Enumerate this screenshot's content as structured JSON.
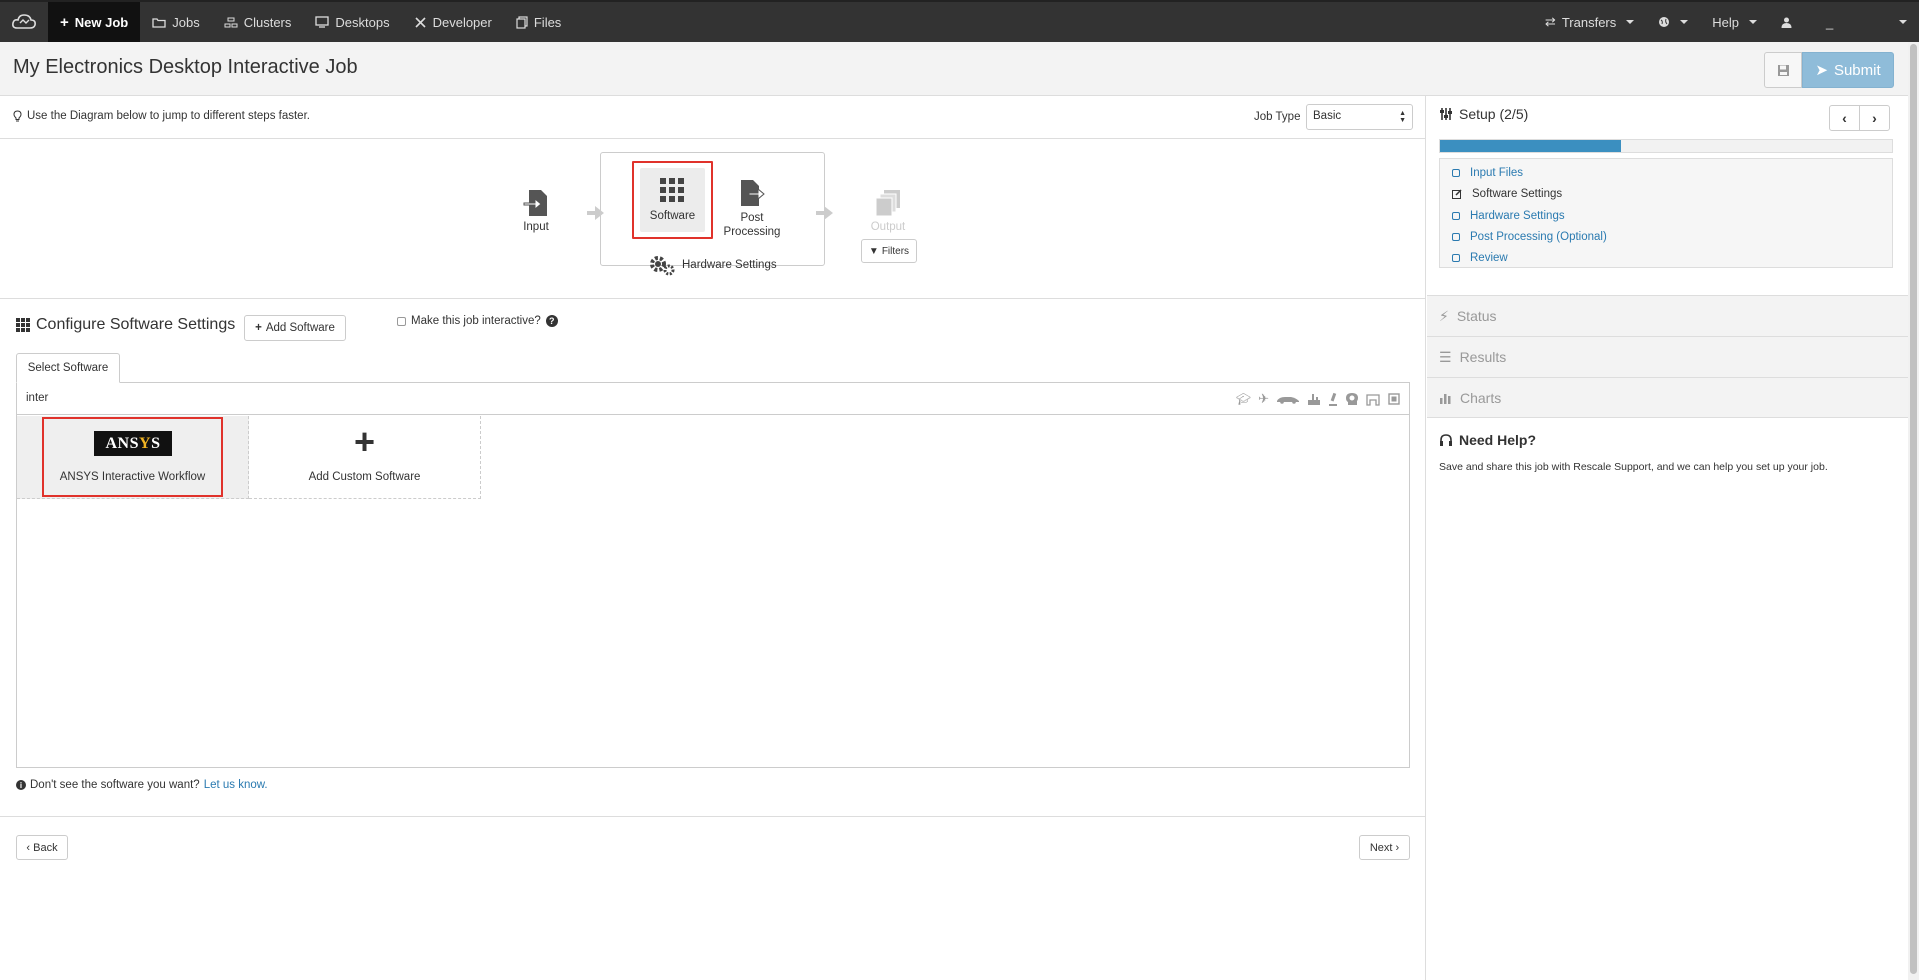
{
  "nav": {
    "items": [
      {
        "label": "New Job",
        "icon": "plus-icon",
        "active": true
      },
      {
        "label": "Jobs",
        "icon": "folder-icon"
      },
      {
        "label": "Clusters",
        "icon": "clusters-icon"
      },
      {
        "label": "Desktops",
        "icon": "monitor-icon"
      },
      {
        "label": "Developer",
        "icon": "tools-icon"
      },
      {
        "label": "Files",
        "icon": "files-icon"
      }
    ],
    "right": {
      "transfers": "Transfers",
      "help": "Help",
      "user": "_"
    }
  },
  "title": "My Electronics Desktop Interactive Job",
  "submit_label": "Submit",
  "hint": "Use the Diagram below to jump to different steps faster.",
  "job_type": {
    "label": "Job Type",
    "value": "Basic"
  },
  "diagram": {
    "input": "Input",
    "software": "Software",
    "post_processing": "Post Processing",
    "hardware_settings": "Hardware Settings",
    "output": "Output",
    "filters": "Filters"
  },
  "configure": {
    "title": "Configure Software Settings",
    "add_software": "Add Software",
    "interactive_label": "Make this job interactive?",
    "tab": "Select Software",
    "filter_value": "inter",
    "tiles": {
      "ansys_logo": "ANSYS",
      "ansys_label": "ANSYS Interactive Workflow",
      "custom_label": "Add Custom Software"
    },
    "dont_see": "Don't see the software you want?",
    "let_us_know": "Let us know."
  },
  "footer": {
    "back": "‹ Back",
    "next": "Next ›"
  },
  "sidebar": {
    "setup_title": "Setup (2/5)",
    "progress": 0.4,
    "steps": [
      {
        "label": "Input Files",
        "state": "link"
      },
      {
        "label": "Software Settings",
        "state": "current"
      },
      {
        "label": "Hardware Settings",
        "state": "link"
      },
      {
        "label": "Post Processing (Optional)",
        "state": "link"
      },
      {
        "label": "Review",
        "state": "link"
      }
    ],
    "status": "Status",
    "results": "Results",
    "charts": "Charts",
    "help_title": "Need Help?",
    "help_text": "Save and share this job with Rescale Support, and we can help you set up your job."
  }
}
